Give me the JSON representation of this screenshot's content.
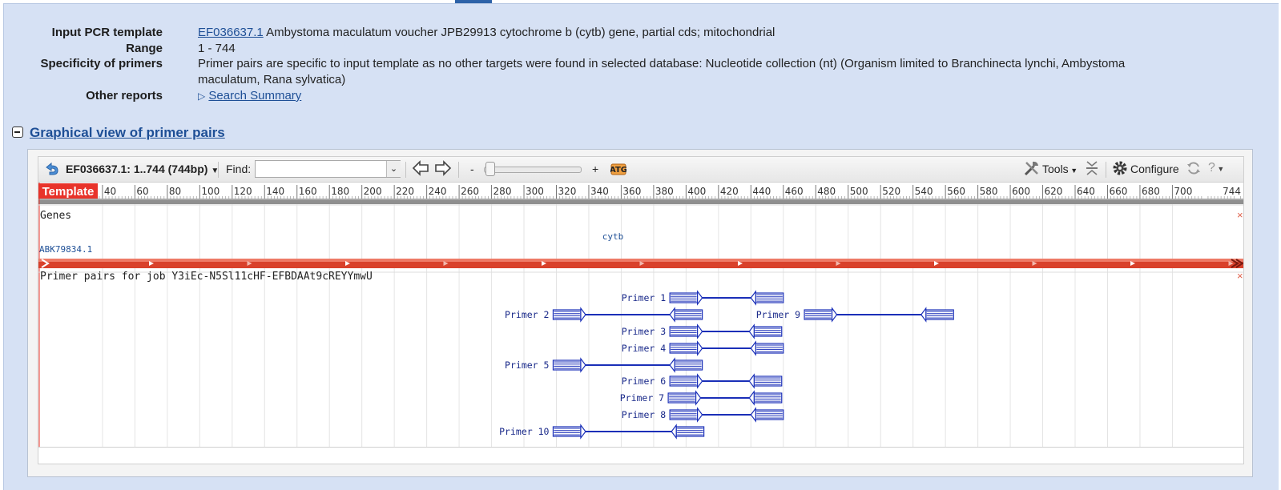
{
  "summary": {
    "template_label": "Input PCR template",
    "template_accession": "EF036637.1",
    "template_desc": "Ambystoma maculatum voucher JPB29913 cytochrome b (cytb) gene, partial cds; mitochondrial",
    "range_label": "Range",
    "range_value": "1 - 744",
    "spec_label": "Specificity of primers",
    "spec_line1": "Primer pairs are specific to input template as no other targets were found in selected database: Nucleotide collection (nt) (Organism limited to Branchinecta lynchi, Ambystoma",
    "spec_line2": "maculatum, Rana sylvatica)",
    "other_label": "Other reports",
    "other_link": "Search Summary"
  },
  "section": {
    "title": "Graphical view of primer pairs"
  },
  "toolbar": {
    "seq_selector": "EF036637.1: 1..744 (744bp)",
    "find_label": "Find:",
    "find_value": "",
    "zoom_minus": "-",
    "zoom_plus": "+",
    "tools_label": "Tools",
    "configure_label": "Configure",
    "help_label": "?"
  },
  "ruler": {
    "label": "Template",
    "ticks": [
      40,
      60,
      80,
      100,
      120,
      140,
      160,
      180,
      200,
      220,
      240,
      260,
      280,
      300,
      320,
      340,
      360,
      380,
      400,
      420,
      440,
      460,
      480,
      500,
      520,
      540,
      560,
      580,
      600,
      620,
      640,
      660,
      680,
      700
    ],
    "end_label": "744"
  },
  "tracks": {
    "genes_title": "Genes",
    "gene_name": "cytb",
    "protein_name": "ABK79834.1",
    "primers_title": "Primer pairs for job Y3iEc-N5Sl11cHF-EFBDAAt9cREYYmwU"
  },
  "primer_pairs": [
    {
      "name": "Primer 1",
      "fwd": [
        390,
        410
      ],
      "rev": [
        440,
        460
      ]
    },
    {
      "name": "Primer 2",
      "fwd": [
        318,
        338
      ],
      "rev": [
        390,
        410
      ]
    },
    {
      "name": "Primer 9",
      "fwd": [
        473,
        493
      ],
      "rev": [
        545,
        565
      ]
    },
    {
      "name": "Primer 3",
      "fwd": [
        390,
        410
      ],
      "rev": [
        439,
        459
      ]
    },
    {
      "name": "Primer 4",
      "fwd": [
        390,
        410
      ],
      "rev": [
        440,
        460
      ]
    },
    {
      "name": "Primer 5",
      "fwd": [
        318,
        338
      ],
      "rev": [
        390,
        410
      ]
    },
    {
      "name": "Primer 6",
      "fwd": [
        390,
        410
      ],
      "rev": [
        439,
        459
      ]
    },
    {
      "name": "Primer 7",
      "fwd": [
        389,
        409
      ],
      "rev": [
        439,
        459
      ]
    },
    {
      "name": "Primer 8",
      "fwd": [
        390,
        410
      ],
      "rev": [
        440,
        460
      ]
    },
    {
      "name": "Primer 10",
      "fwd": [
        318,
        338
      ],
      "rev": [
        391,
        411
      ]
    }
  ],
  "colors": {
    "accent": "#1e4f96",
    "gene_bar": "#d9412b",
    "primer": "#1a2fb8",
    "ruler_red": "#e8332a"
  }
}
